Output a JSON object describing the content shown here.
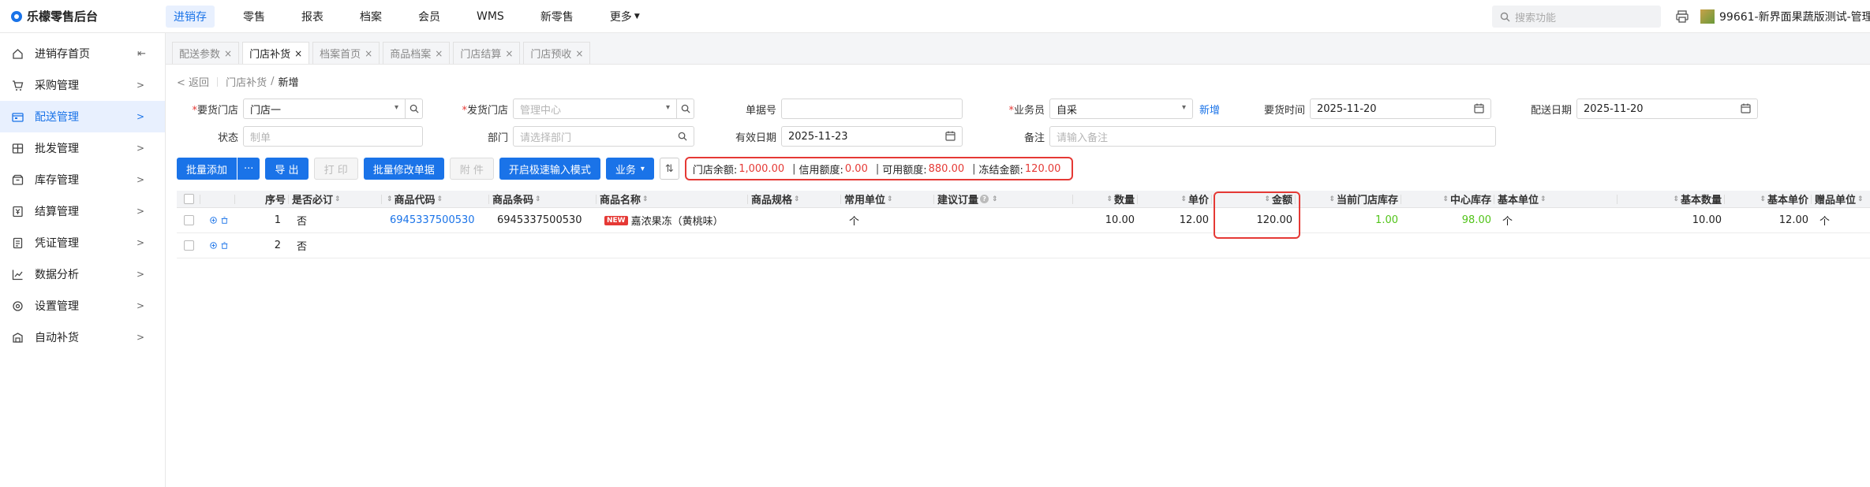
{
  "app": {
    "title": "乐檬零售后台"
  },
  "topnav": [
    {
      "label": "进销存",
      "active": true
    },
    {
      "label": "零售"
    },
    {
      "label": "报表"
    },
    {
      "label": "档案"
    },
    {
      "label": "会员"
    },
    {
      "label": "WMS"
    },
    {
      "label": "新零售"
    },
    {
      "label": "更多"
    }
  ],
  "top_search": {
    "placeholder": "搜索功能"
  },
  "user": {
    "name": "99661-新界面果蔬版测试-管理"
  },
  "sidebar": {
    "items": [
      {
        "label": "进销存首页",
        "icon": "home-icon"
      },
      {
        "label": "采购管理",
        "icon": "cart-icon"
      },
      {
        "label": "配送管理",
        "icon": "truck-icon",
        "active": true
      },
      {
        "label": "批发管理",
        "icon": "wholesale-icon"
      },
      {
        "label": "库存管理",
        "icon": "inventory-icon"
      },
      {
        "label": "结算管理",
        "icon": "settlement-icon"
      },
      {
        "label": "凭证管理",
        "icon": "voucher-icon"
      },
      {
        "label": "数据分析",
        "icon": "analytics-icon"
      },
      {
        "label": "设置管理",
        "icon": "settings-icon"
      },
      {
        "label": "自动补货",
        "icon": "auto-restock-icon"
      }
    ]
  },
  "tabs": [
    {
      "label": "配送参数"
    },
    {
      "label": "门店补货",
      "active": true
    },
    {
      "label": "档案首页"
    },
    {
      "label": "商品档案"
    },
    {
      "label": "门店结算"
    },
    {
      "label": "门店预收"
    }
  ],
  "breadcrumb": {
    "back": "返回",
    "parent": "门店补货",
    "sep": "/",
    "current": "新增"
  },
  "form": {
    "req_store": {
      "label": "要货门店",
      "value": "门店一"
    },
    "ship_store": {
      "label": "发货门店",
      "placeholder": "管理中心"
    },
    "order_no": {
      "label": "单据号",
      "value": ""
    },
    "salesman": {
      "label": "业务员",
      "value": "自采",
      "link": "新增"
    },
    "req_time": {
      "label": "要货时间",
      "value": "2025-11-20"
    },
    "ship_date": {
      "label": "配送日期",
      "value": "2025-11-20"
    },
    "status": {
      "label": "状态",
      "placeholder": "制单"
    },
    "dept": {
      "label": "部门",
      "placeholder": "请选择部门"
    },
    "valid_date": {
      "label": "有效日期",
      "value": "2025-11-23"
    },
    "remark": {
      "label": "备注",
      "placeholder": "请输入备注"
    }
  },
  "toolbar": {
    "batch_add": "批量添加",
    "more": "···",
    "export": "导 出",
    "print": "打 印",
    "batch_edit": "批量修改单据",
    "attach": "附 件",
    "fast_input": "开启极速输入模式",
    "business": "业务"
  },
  "summary": {
    "store_balance_label": "门店余额:",
    "store_balance": "1,000.00",
    "credit_label": "信用额度:",
    "credit": "0.00",
    "available_label": "可用额度:",
    "available": "880.00",
    "frozen_label": "冻结金额:",
    "frozen": "120.00",
    "sep": "|"
  },
  "grid": {
    "headers": {
      "seq": "序号",
      "must": "是否必订",
      "code": "商品代码",
      "barcode": "商品条码",
      "name": "商品名称",
      "spec": "商品规格",
      "unit": "常用单位",
      "suggest": "建议订量",
      "qty": "数量",
      "price": "单价",
      "amount": "金额",
      "store_stock": "当前门店库存",
      "center_stock": "中心库存",
      "base_unit": "基本单位",
      "base_qty": "基本数量",
      "base_price": "基本单价",
      "gift_unit": "赠品单位"
    },
    "rows": [
      {
        "seq": "1",
        "must": "否",
        "code": "6945337500530",
        "barcode": "6945337500530",
        "new_tag": "NEW",
        "name": "嘉浓果冻（黄桃味）",
        "spec": "",
        "unit": "个",
        "suggest": "",
        "qty": "10.00",
        "price": "12.00",
        "amount": "120.00",
        "store_stock": "1.00",
        "center_stock": "98.00",
        "base_unit": "个",
        "base_qty": "10.00",
        "base_price": "12.00",
        "gift_unit": "个"
      },
      {
        "seq": "2",
        "must": "否"
      }
    ]
  },
  "colors": {
    "accent": "#1a73e8",
    "danger": "#e53935",
    "positive": "#52c41a"
  }
}
